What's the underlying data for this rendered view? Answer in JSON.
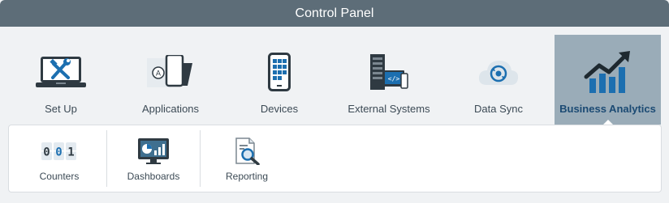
{
  "window": {
    "title": "Control Panel"
  },
  "top_nav": {
    "items": [
      {
        "label": "Set Up",
        "icon": "laptop-tools-icon",
        "active": false
      },
      {
        "label": "Applications",
        "icon": "apps-phone-icon",
        "active": false
      },
      {
        "label": "Devices",
        "icon": "smartphone-icon",
        "active": false
      },
      {
        "label": "External Systems",
        "icon": "server-devices-icon",
        "active": false
      },
      {
        "label": "Data Sync",
        "icon": "cloud-sync-icon",
        "active": false
      },
      {
        "label": "Business Analytics",
        "icon": "growth-chart-icon",
        "active": true
      }
    ]
  },
  "sub_nav": {
    "items": [
      {
        "label": "Counters",
        "icon": "counter-digits-icon"
      },
      {
        "label": "Dashboards",
        "icon": "dashboard-monitor-icon"
      },
      {
        "label": "Reporting",
        "icon": "report-magnifier-icon"
      }
    ]
  },
  "colors": {
    "title_bar": "#5d6d78",
    "active_tab": "#9aacb8",
    "active_label": "#1b4a73",
    "background": "#f0f2f4"
  }
}
